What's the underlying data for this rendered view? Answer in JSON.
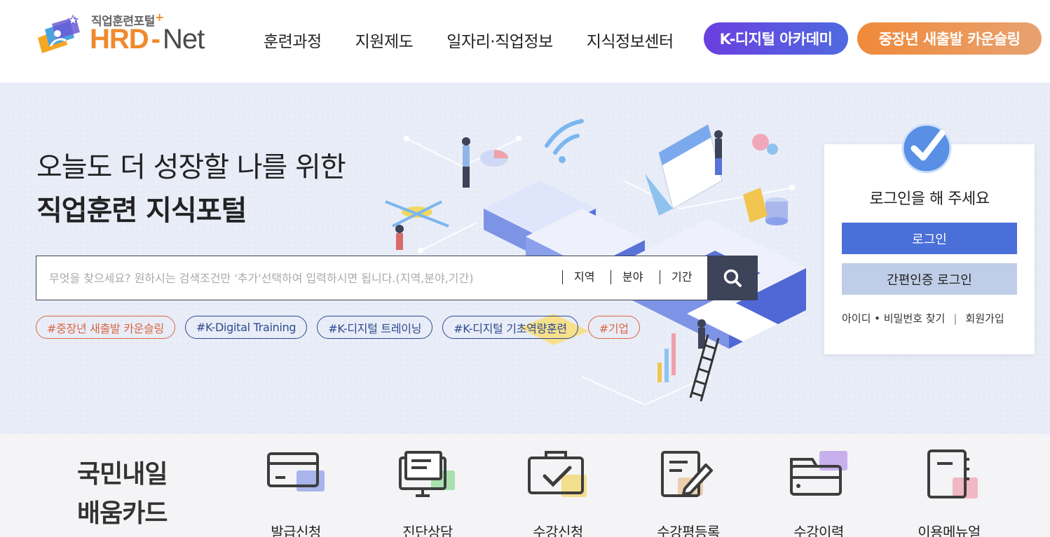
{
  "header": {
    "logo_sub": "직업훈련포털",
    "logo_plus": "+",
    "logo_hrd": "HRD",
    "logo_dash": "-",
    "logo_net": "Net",
    "nav": [
      {
        "label": "훈련과정"
      },
      {
        "label": "지원제도"
      },
      {
        "label": "일자리·직업정보"
      },
      {
        "label": "지식정보센터"
      }
    ],
    "kdigital_label": "K-디지털 아카데미",
    "counsel_label": "중장년 새출발 카운슬링"
  },
  "hero": {
    "title_line1": "오늘도 더 성장할 나를 위한",
    "title_line2": "직업훈련 지식포털",
    "search": {
      "placeholder": "무엇을 찾으세요? 원하시는 검색조건만 '추가'선택하여 입력하시면 됩니다.(지역,분야,기간)",
      "value": "",
      "filters": [
        "지역",
        "분야",
        "기간"
      ]
    },
    "tags": [
      {
        "label": "#중장년 새출발 카운슬링",
        "color": "#d9673f"
      },
      {
        "label": "#K-Digital Training",
        "color": "#2d4a8e"
      },
      {
        "label": "#K-디지털 트레이닝",
        "color": "#2d4a8e"
      },
      {
        "label": "#K-디지털 기초역량훈련",
        "color": "#2d4a8e"
      },
      {
        "label": "#기업",
        "color": "#d9673f"
      }
    ]
  },
  "login": {
    "message": "로그인을 해 주세요",
    "login_button": "로그인",
    "easy_login_button": "간편인증 로그인",
    "find_label": "아이디 • 비밀번호 찾기",
    "separator": "|",
    "signup_label": "회원가입"
  },
  "card": {
    "title_line1": "국민내일",
    "title_line2": "배움카드",
    "services": [
      {
        "label": "발급신청",
        "icon": "card-icon",
        "accent": "#a9b4ec"
      },
      {
        "label": "진단상담",
        "icon": "monitor-icon",
        "accent": "#a8e0b0"
      },
      {
        "label": "수강신청",
        "icon": "checkbox-icon",
        "accent": "#f2de8c"
      },
      {
        "label": "수강평등록",
        "icon": "pencil-doc-icon",
        "accent": "#eccfae"
      },
      {
        "label": "수강이력",
        "icon": "folder-icon",
        "accent": "#c8b0ec"
      },
      {
        "label": "이용메뉴얼",
        "icon": "notebook-icon",
        "accent": "#f0b8c2"
      }
    ]
  },
  "colors": {
    "brand_orange": "#f08a2c",
    "login_blue": "#4a6fd8",
    "search_dark": "#3d4358"
  }
}
